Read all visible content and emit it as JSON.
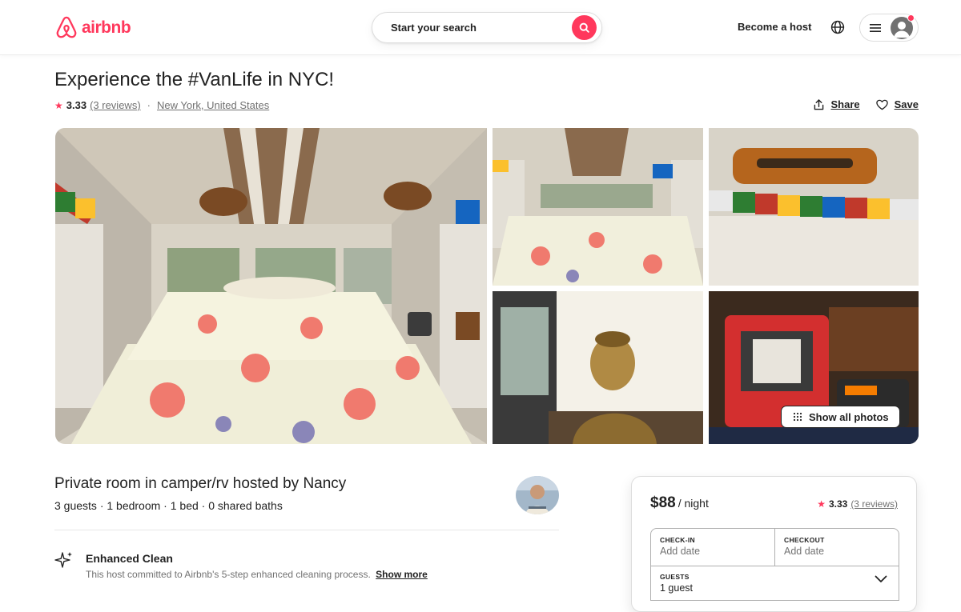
{
  "header": {
    "logo_text": "airbnb",
    "search_placeholder": "Start your search",
    "become_host": "Become a host"
  },
  "listing": {
    "title": "Experience the #VanLife in NYC!",
    "rating": "3.33",
    "reviews_link": "(3 reviews)",
    "separator": "·",
    "location": "New York, United States",
    "share_label": "Share",
    "save_label": "Save"
  },
  "gallery": {
    "show_all_label": "Show all photos",
    "photos": [
      "van-interior-bed",
      "van-bed-closeup",
      "prayer-flags-shelf",
      "buddha-statue",
      "heater-and-power-station"
    ]
  },
  "details": {
    "host_title": "Private room in camper/rv hosted by Nancy",
    "summary": "3 guests · 1 bedroom · 1 bed · 0 shared baths",
    "highlight_title": "Enhanced Clean",
    "highlight_desc": "This host committed to Airbnb's 5-step enhanced cleaning process.",
    "highlight_more": "Show more"
  },
  "booking": {
    "price": "$88",
    "per": "/ night",
    "rating": "3.33",
    "reviews_link": "(3 reviews)",
    "checkin_label": "CHECK-IN",
    "checkin_value": "Add date",
    "checkout_label": "CHECKOUT",
    "checkout_value": "Add date",
    "guests_label": "GUESTS",
    "guests_value": "1 guest"
  },
  "colors": {
    "brand": "#ff385c",
    "text": "#222222",
    "muted": "#717171"
  }
}
